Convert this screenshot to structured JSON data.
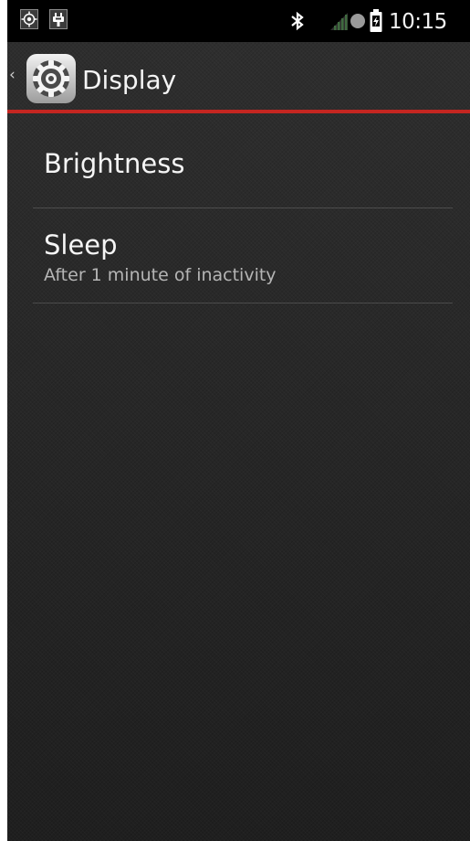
{
  "status_bar": {
    "time": "10:15",
    "notification_icons": [
      "gps-target-icon",
      "usb-debug-icon"
    ],
    "system_icons": [
      "bluetooth-icon",
      "cell-signal-icon",
      "sync-dot-icon",
      "battery-charging-icon"
    ]
  },
  "action_bar": {
    "title": "Display",
    "up_caret": "‹",
    "app_icon": "settings-gear-icon",
    "accent_color": "#c42621"
  },
  "settings_list": {
    "items": [
      {
        "title": "Brightness"
      },
      {
        "title": "Sleep",
        "summary": "After 1 minute of inactivity"
      }
    ]
  },
  "colors": {
    "background": "#262626",
    "status_bar": "#000000",
    "text_primary": "#f5f5f5",
    "text_secondary": "#b5b5b5"
  }
}
